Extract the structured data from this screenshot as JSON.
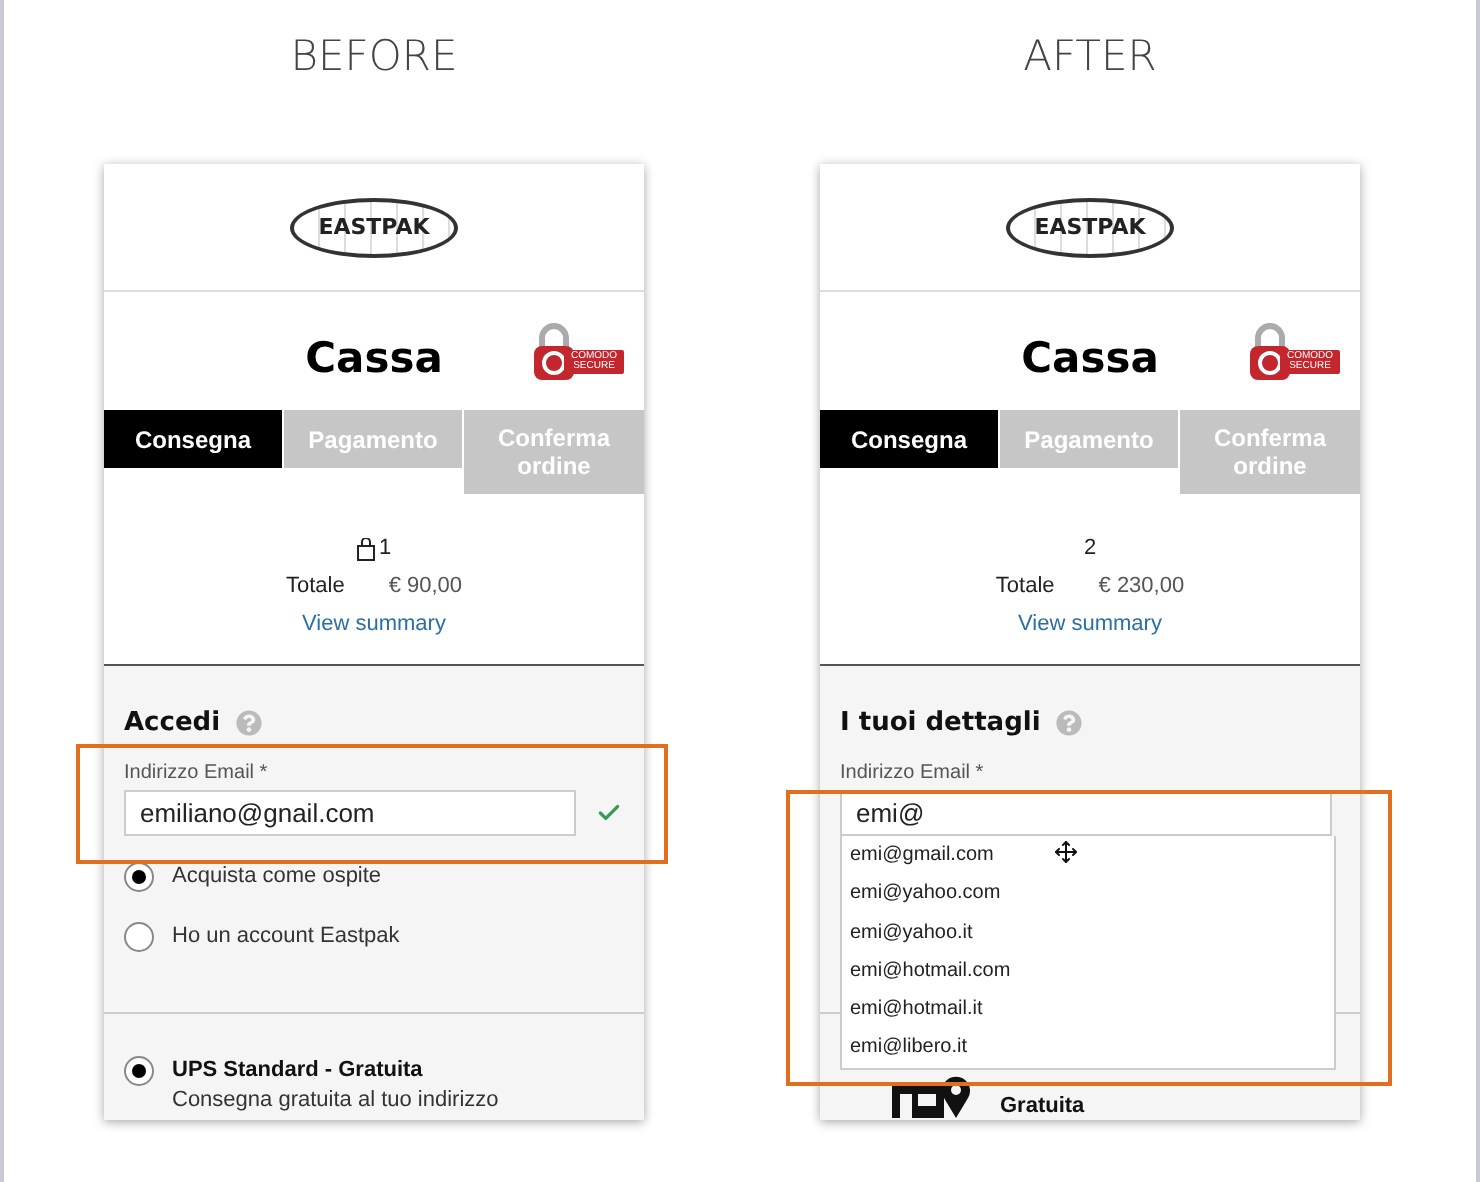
{
  "panels": [
    {
      "caption": "BEFORE",
      "logo": "EASTPAK",
      "title": "Cassa",
      "badge": "COMODO SECURE",
      "tabs": [
        {
          "label": "Consegna",
          "selected": true
        },
        {
          "label": "Pagamento",
          "selected": false
        },
        {
          "label": "Conferma ordine",
          "selected": false
        }
      ],
      "cart": {
        "count": "1",
        "show_bag": true,
        "total_label": "Totale",
        "total": "€ 90,00",
        "link": "View summary"
      },
      "form": {
        "heading": "Accedi",
        "email_label": "Indirizzo Email *",
        "email_value": "emiliano@gnail.com",
        "valid": true,
        "highlighted": true,
        "options": [
          {
            "label": "Acquista come ospite",
            "selected": true
          },
          {
            "label": "Ho un account Eastpak",
            "selected": false
          }
        ]
      },
      "shipping": {
        "kind": "radio",
        "label": "UPS Standard - Gratuita",
        "description": "Consegna gratuita al tuo indirizzo",
        "selected": true
      }
    },
    {
      "caption": "AFTER",
      "logo": "EASTPAK",
      "title": "Cassa",
      "badge": "COMODO SECURE",
      "tabs": [
        {
          "label": "Consegna",
          "selected": true
        },
        {
          "label": "Pagamento",
          "selected": false
        },
        {
          "label": "Conferma ordine",
          "selected": false
        }
      ],
      "cart": {
        "count": "2",
        "show_bag": false,
        "total_label": "Totale",
        "total": "€ 230,00",
        "link": "View summary"
      },
      "form": {
        "heading": "I tuoi dettagli",
        "email_label": "Indirizzo Email *",
        "email_value": "emi@",
        "valid": false,
        "highlighted": true,
        "suggestions": [
          "emi@gmail.com",
          "emi@yahoo.com",
          "emi@yahoo.it",
          "emi@hotmail.com",
          "emi@hotmail.it",
          "emi@libero.it"
        ]
      },
      "shipping": {
        "kind": "pickup",
        "label": "Gratuita"
      }
    }
  ]
}
